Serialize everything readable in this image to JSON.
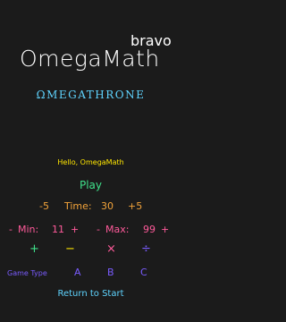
{
  "logo": {
    "title": "OmegaMath",
    "subtitle": "bravo"
  },
  "brand": "ΩMEGATHRONE",
  "greeting": "Hello, OmegaMath",
  "play_label": "Play",
  "time_row": {
    "minus": "-5",
    "label": "Time:",
    "value": "30",
    "plus": "+5"
  },
  "min_row": {
    "minus": "-",
    "label": "Min:",
    "value": "11",
    "plus": "+"
  },
  "max_row": {
    "minus": "-",
    "label": "Max:",
    "value": "99",
    "plus": "+"
  },
  "operations": {
    "add": "+",
    "subtract": "−",
    "multiply": "×",
    "divide": "÷"
  },
  "game_type": {
    "label": "Game Type",
    "options": [
      "A",
      "B",
      "C"
    ]
  },
  "return_label": "Return to Start"
}
